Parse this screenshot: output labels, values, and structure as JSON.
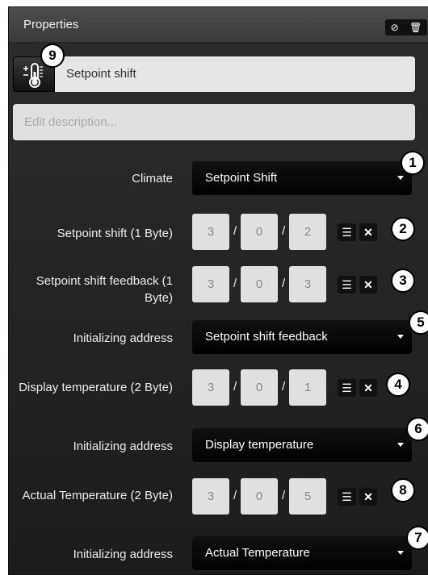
{
  "panel": {
    "title": "Properties",
    "icons": [
      "check-circle-icon",
      "trash-icon"
    ]
  },
  "device": {
    "name": "Setpoint shift",
    "icon": "thermometer-icon"
  },
  "description": {
    "value": "",
    "placeholder": "Edit description..."
  },
  "climate": {
    "label": "Climate",
    "selected": "Setpoint Shift"
  },
  "setpoint_shift": {
    "label": "Setpoint shift (1 Byte)",
    "address": [
      "3",
      "0",
      "2"
    ]
  },
  "setpoint_feedback": {
    "label": "Setpoint shift feedback (1 Byte)",
    "address": [
      "3",
      "0",
      "3"
    ]
  },
  "init_address_1": {
    "label": "Initializing address",
    "selected": "Setpoint shift feedback"
  },
  "display_temperature": {
    "label": "Display temperature (2 Byte)",
    "address": [
      "3",
      "0",
      "1"
    ]
  },
  "init_address_2": {
    "label": "Initializing address",
    "selected": "Display temperature"
  },
  "actual_temperature": {
    "label": "Actual Temperature (2 Byte)",
    "address": [
      "3",
      "0",
      "5"
    ]
  },
  "init_address_3": {
    "label": "Initializing address",
    "selected": "Actual Temperature"
  },
  "badges": {
    "b1": "1",
    "b2": "2",
    "b3": "3",
    "b4": "4",
    "b5": "5",
    "b6": "6",
    "b7": "7",
    "b8": "8",
    "b9": "9"
  }
}
